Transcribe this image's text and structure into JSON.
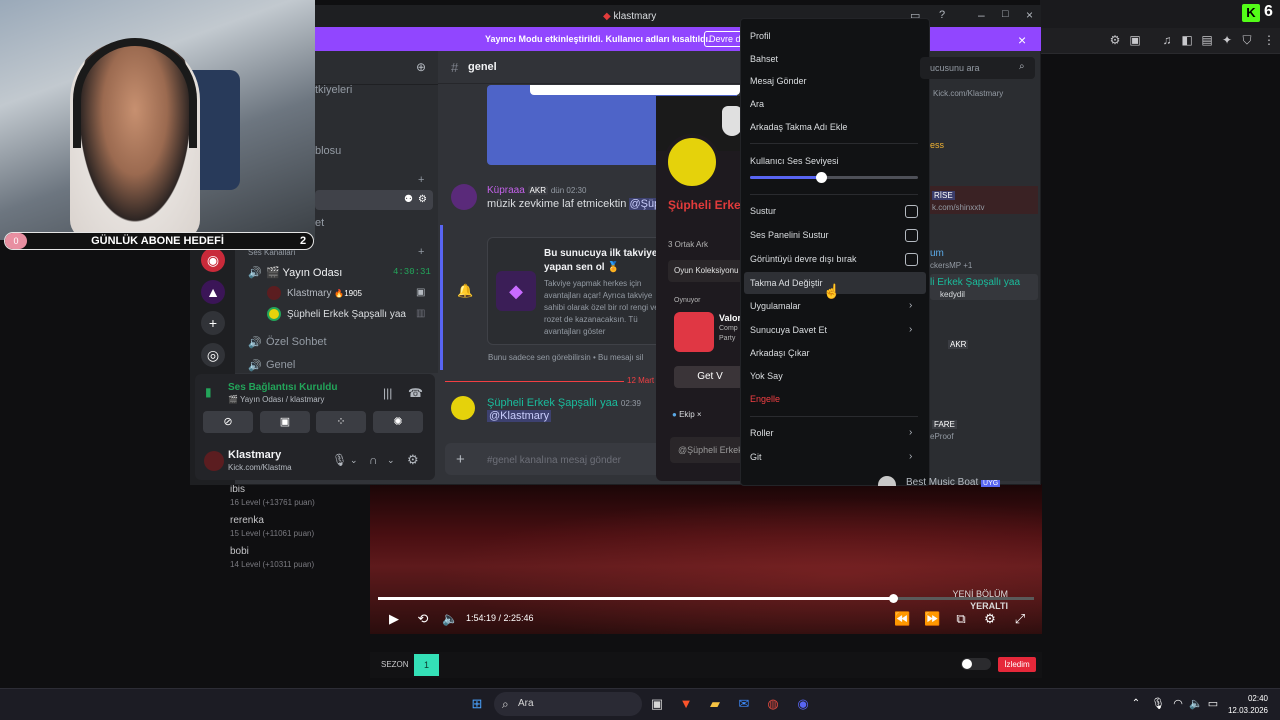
{
  "browser": {
    "kick_number": "6",
    "leaderboard": [
      {
        "name": "ibis",
        "points": "16 Level (+13761 puan)"
      },
      {
        "name": "rerenka",
        "points": "15 Level (+11061 puan)"
      },
      {
        "name": "bobi",
        "points": "14 Level (+10311 puan)"
      }
    ]
  },
  "video": {
    "current_time": "1:54:19  /  2:25:46",
    "overlay_line1": "YENİ BÖLÜM",
    "overlay_line2": "YERALTI",
    "progress": 0.785,
    "season_label": "SEZON",
    "season_value": "1",
    "watched_label": "İzledim"
  },
  "webcam": {
    "goal_label": "GÜNLÜK ABONE HEDEFİ",
    "goal_current": "0",
    "goal_target": "2"
  },
  "discord": {
    "window_title": "klastmary",
    "streamer_banner": "Yayıncı Modu etkinleştirildi. Kullanıcı adları kısaltıldı.",
    "streamer_button": "Devre d",
    "channels": {
      "partial1": "tkiyeleri",
      "partial2": "blosu",
      "partial3": "et",
      "voice_category": "Ses Kanalları",
      "voice_room": "🎬 Yayın Odası",
      "voice_timer": "4:30:31",
      "voice_user1": "Klastmary",
      "voice_user1_badge": "🔥1905",
      "voice_user2": "Şüpheli Erkek Şapşallı yaa",
      "private_chat": "Özel Sohbet",
      "general": "Genel"
    },
    "voice_panel": {
      "status": "Ses Bağlantısı Kuruldu",
      "sub": "🎬 Yayın Odası / klastmary"
    },
    "user": {
      "name": "Klastmary",
      "status": "Kick.com/Klastma"
    },
    "chat": {
      "channel": "genel",
      "msg1_author": "Küpraaa",
      "msg1_tag": "AKR",
      "msg1_time": "dün 02:30",
      "msg1_text": "müzik zevkime laf etmicektin ",
      "msg1_mention": "@Şüph",
      "boost_title": "Bu sunucuya ilk takviye yapan sen ol 🏅",
      "boost_body": "Takviye yapmak herkes için avantajları açar! Ayrıca takviye sahibi olarak özel bir rol rengi ve rozet de kazanacaksın. Tü avantajları göster",
      "only_you": "Bunu sadece sen görebilirsin • Bu mesajı sil",
      "date_divider": "12 Mart 2",
      "msg2_author": "Şüpheli Erkek Şapşallı yaa",
      "msg2_time": "02:39",
      "msg2_mention": "@Klastmary",
      "composer_placeholder": "#genel kanalına mesaj gönder"
    },
    "profile": {
      "name": "Şüpheli Erkek",
      "common": "3 Ortak Ark",
      "collection": "Oyun Koleksiyonu",
      "playing_label": "Oynuyor",
      "game": "Valor",
      "game_sub1": "Comp",
      "game_sub2": "Party",
      "get_button": "Get V",
      "tag": "Ekip",
      "input_placeholder": "@Şüpheli Erkek"
    },
    "context_menu": {
      "items": [
        "Profil",
        "Bahset",
        "Mesaj Gönder",
        "Ara",
        "Arkadaş Takma Adı Ekle"
      ],
      "volume_label": "Kullanıcı Ses Seviyesi",
      "volume": 0.42,
      "checks": [
        "Sustur",
        "Ses Panelini Sustur",
        "Görüntüyü devre dışı bırak"
      ],
      "nickname": "Takma Ad Değiştir",
      "apps": "Uygulamalar",
      "invite": "Sunucuya Davet Et",
      "remove_friend": "Arkadaşı Çıkar",
      "ignore": "Yok Say",
      "block": "Engelle",
      "roles": "Roller",
      "go": "Git"
    },
    "members": {
      "search_placeholder": "ucusunu ara",
      "m1": "Kick.com/Klastmary",
      "m2": "ess",
      "m3_tag": "RİSE",
      "m3_sub": "k.com/shinxxtv",
      "m4": "um",
      "m4_sub": "ckersMP +1",
      "m5": "li Erkek Şapşallı yaa",
      "m5_sub": "kedydil",
      "m6_tag": "AKR",
      "m7_tag": "FARE",
      "m7_sub": "eProof",
      "m8": "Best Music Boat",
      "m8_tag": "UYG"
    }
  },
  "taskbar": {
    "search": "Ara",
    "time": "02:40",
    "date": "12.03.2026"
  }
}
